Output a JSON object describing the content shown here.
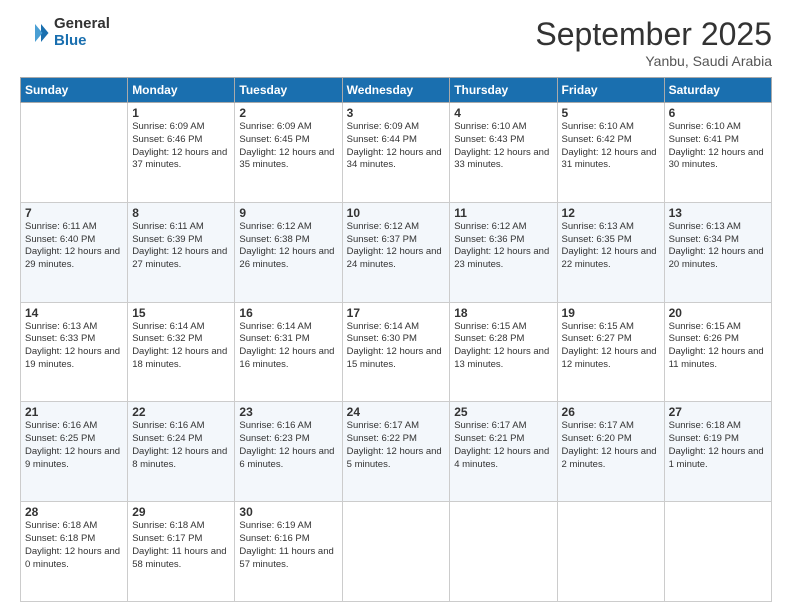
{
  "logo": {
    "general": "General",
    "blue": "Blue"
  },
  "header": {
    "month": "September 2025",
    "location": "Yanbu, Saudi Arabia"
  },
  "days": [
    "Sunday",
    "Monday",
    "Tuesday",
    "Wednesday",
    "Thursday",
    "Friday",
    "Saturday"
  ],
  "weeks": [
    [
      {
        "day": "",
        "sunrise": "",
        "sunset": "",
        "daylight": ""
      },
      {
        "day": "1",
        "sunrise": "Sunrise: 6:09 AM",
        "sunset": "Sunset: 6:46 PM",
        "daylight": "Daylight: 12 hours and 37 minutes."
      },
      {
        "day": "2",
        "sunrise": "Sunrise: 6:09 AM",
        "sunset": "Sunset: 6:45 PM",
        "daylight": "Daylight: 12 hours and 35 minutes."
      },
      {
        "day": "3",
        "sunrise": "Sunrise: 6:09 AM",
        "sunset": "Sunset: 6:44 PM",
        "daylight": "Daylight: 12 hours and 34 minutes."
      },
      {
        "day": "4",
        "sunrise": "Sunrise: 6:10 AM",
        "sunset": "Sunset: 6:43 PM",
        "daylight": "Daylight: 12 hours and 33 minutes."
      },
      {
        "day": "5",
        "sunrise": "Sunrise: 6:10 AM",
        "sunset": "Sunset: 6:42 PM",
        "daylight": "Daylight: 12 hours and 31 minutes."
      },
      {
        "day": "6",
        "sunrise": "Sunrise: 6:10 AM",
        "sunset": "Sunset: 6:41 PM",
        "daylight": "Daylight: 12 hours and 30 minutes."
      }
    ],
    [
      {
        "day": "7",
        "sunrise": "Sunrise: 6:11 AM",
        "sunset": "Sunset: 6:40 PM",
        "daylight": "Daylight: 12 hours and 29 minutes."
      },
      {
        "day": "8",
        "sunrise": "Sunrise: 6:11 AM",
        "sunset": "Sunset: 6:39 PM",
        "daylight": "Daylight: 12 hours and 27 minutes."
      },
      {
        "day": "9",
        "sunrise": "Sunrise: 6:12 AM",
        "sunset": "Sunset: 6:38 PM",
        "daylight": "Daylight: 12 hours and 26 minutes."
      },
      {
        "day": "10",
        "sunrise": "Sunrise: 6:12 AM",
        "sunset": "Sunset: 6:37 PM",
        "daylight": "Daylight: 12 hours and 24 minutes."
      },
      {
        "day": "11",
        "sunrise": "Sunrise: 6:12 AM",
        "sunset": "Sunset: 6:36 PM",
        "daylight": "Daylight: 12 hours and 23 minutes."
      },
      {
        "day": "12",
        "sunrise": "Sunrise: 6:13 AM",
        "sunset": "Sunset: 6:35 PM",
        "daylight": "Daylight: 12 hours and 22 minutes."
      },
      {
        "day": "13",
        "sunrise": "Sunrise: 6:13 AM",
        "sunset": "Sunset: 6:34 PM",
        "daylight": "Daylight: 12 hours and 20 minutes."
      }
    ],
    [
      {
        "day": "14",
        "sunrise": "Sunrise: 6:13 AM",
        "sunset": "Sunset: 6:33 PM",
        "daylight": "Daylight: 12 hours and 19 minutes."
      },
      {
        "day": "15",
        "sunrise": "Sunrise: 6:14 AM",
        "sunset": "Sunset: 6:32 PM",
        "daylight": "Daylight: 12 hours and 18 minutes."
      },
      {
        "day": "16",
        "sunrise": "Sunrise: 6:14 AM",
        "sunset": "Sunset: 6:31 PM",
        "daylight": "Daylight: 12 hours and 16 minutes."
      },
      {
        "day": "17",
        "sunrise": "Sunrise: 6:14 AM",
        "sunset": "Sunset: 6:30 PM",
        "daylight": "Daylight: 12 hours and 15 minutes."
      },
      {
        "day": "18",
        "sunrise": "Sunrise: 6:15 AM",
        "sunset": "Sunset: 6:28 PM",
        "daylight": "Daylight: 12 hours and 13 minutes."
      },
      {
        "day": "19",
        "sunrise": "Sunrise: 6:15 AM",
        "sunset": "Sunset: 6:27 PM",
        "daylight": "Daylight: 12 hours and 12 minutes."
      },
      {
        "day": "20",
        "sunrise": "Sunrise: 6:15 AM",
        "sunset": "Sunset: 6:26 PM",
        "daylight": "Daylight: 12 hours and 11 minutes."
      }
    ],
    [
      {
        "day": "21",
        "sunrise": "Sunrise: 6:16 AM",
        "sunset": "Sunset: 6:25 PM",
        "daylight": "Daylight: 12 hours and 9 minutes."
      },
      {
        "day": "22",
        "sunrise": "Sunrise: 6:16 AM",
        "sunset": "Sunset: 6:24 PM",
        "daylight": "Daylight: 12 hours and 8 minutes."
      },
      {
        "day": "23",
        "sunrise": "Sunrise: 6:16 AM",
        "sunset": "Sunset: 6:23 PM",
        "daylight": "Daylight: 12 hours and 6 minutes."
      },
      {
        "day": "24",
        "sunrise": "Sunrise: 6:17 AM",
        "sunset": "Sunset: 6:22 PM",
        "daylight": "Daylight: 12 hours and 5 minutes."
      },
      {
        "day": "25",
        "sunrise": "Sunrise: 6:17 AM",
        "sunset": "Sunset: 6:21 PM",
        "daylight": "Daylight: 12 hours and 4 minutes."
      },
      {
        "day": "26",
        "sunrise": "Sunrise: 6:17 AM",
        "sunset": "Sunset: 6:20 PM",
        "daylight": "Daylight: 12 hours and 2 minutes."
      },
      {
        "day": "27",
        "sunrise": "Sunrise: 6:18 AM",
        "sunset": "Sunset: 6:19 PM",
        "daylight": "Daylight: 12 hours and 1 minute."
      }
    ],
    [
      {
        "day": "28",
        "sunrise": "Sunrise: 6:18 AM",
        "sunset": "Sunset: 6:18 PM",
        "daylight": "Daylight: 12 hours and 0 minutes."
      },
      {
        "day": "29",
        "sunrise": "Sunrise: 6:18 AM",
        "sunset": "Sunset: 6:17 PM",
        "daylight": "Daylight: 11 hours and 58 minutes."
      },
      {
        "day": "30",
        "sunrise": "Sunrise: 6:19 AM",
        "sunset": "Sunset: 6:16 PM",
        "daylight": "Daylight: 11 hours and 57 minutes."
      },
      {
        "day": "",
        "sunrise": "",
        "sunset": "",
        "daylight": ""
      },
      {
        "day": "",
        "sunrise": "",
        "sunset": "",
        "daylight": ""
      },
      {
        "day": "",
        "sunrise": "",
        "sunset": "",
        "daylight": ""
      },
      {
        "day": "",
        "sunrise": "",
        "sunset": "",
        "daylight": ""
      }
    ]
  ]
}
